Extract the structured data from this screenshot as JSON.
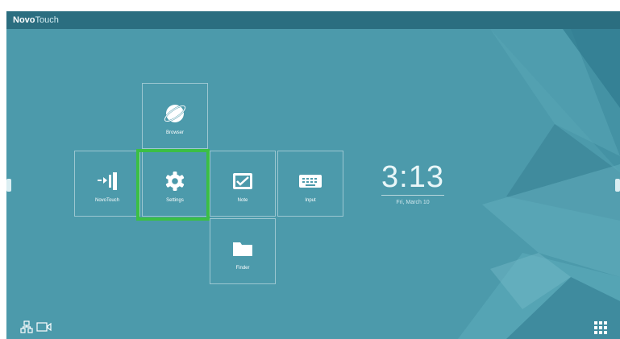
{
  "titlebar": {
    "brand_bold": "Novo",
    "brand_light": "Touch"
  },
  "tiles": [
    {
      "label": "Browser",
      "icon": "globe-icon"
    },
    {
      "label": "NovoTouch",
      "icon": "novotouch-icon"
    },
    {
      "label": "Settings",
      "icon": "gear-icon"
    },
    {
      "label": "Note",
      "icon": "note-icon"
    },
    {
      "label": "Input",
      "icon": "input-icon"
    },
    {
      "label": "Finder",
      "icon": "folder-icon"
    }
  ],
  "selected_tile": "Settings",
  "clock": {
    "time": "3:13",
    "date": "Fri, March 10"
  },
  "bottom_bar": {
    "left_icons": [
      "network-icon",
      "screen-share-icon"
    ],
    "right_icon": "app-grid-icon"
  },
  "colors": {
    "background": "#4c9aab",
    "titlebar": "#2b6e80",
    "highlight": "#3bbf45",
    "tile_border": "#ffffff"
  }
}
